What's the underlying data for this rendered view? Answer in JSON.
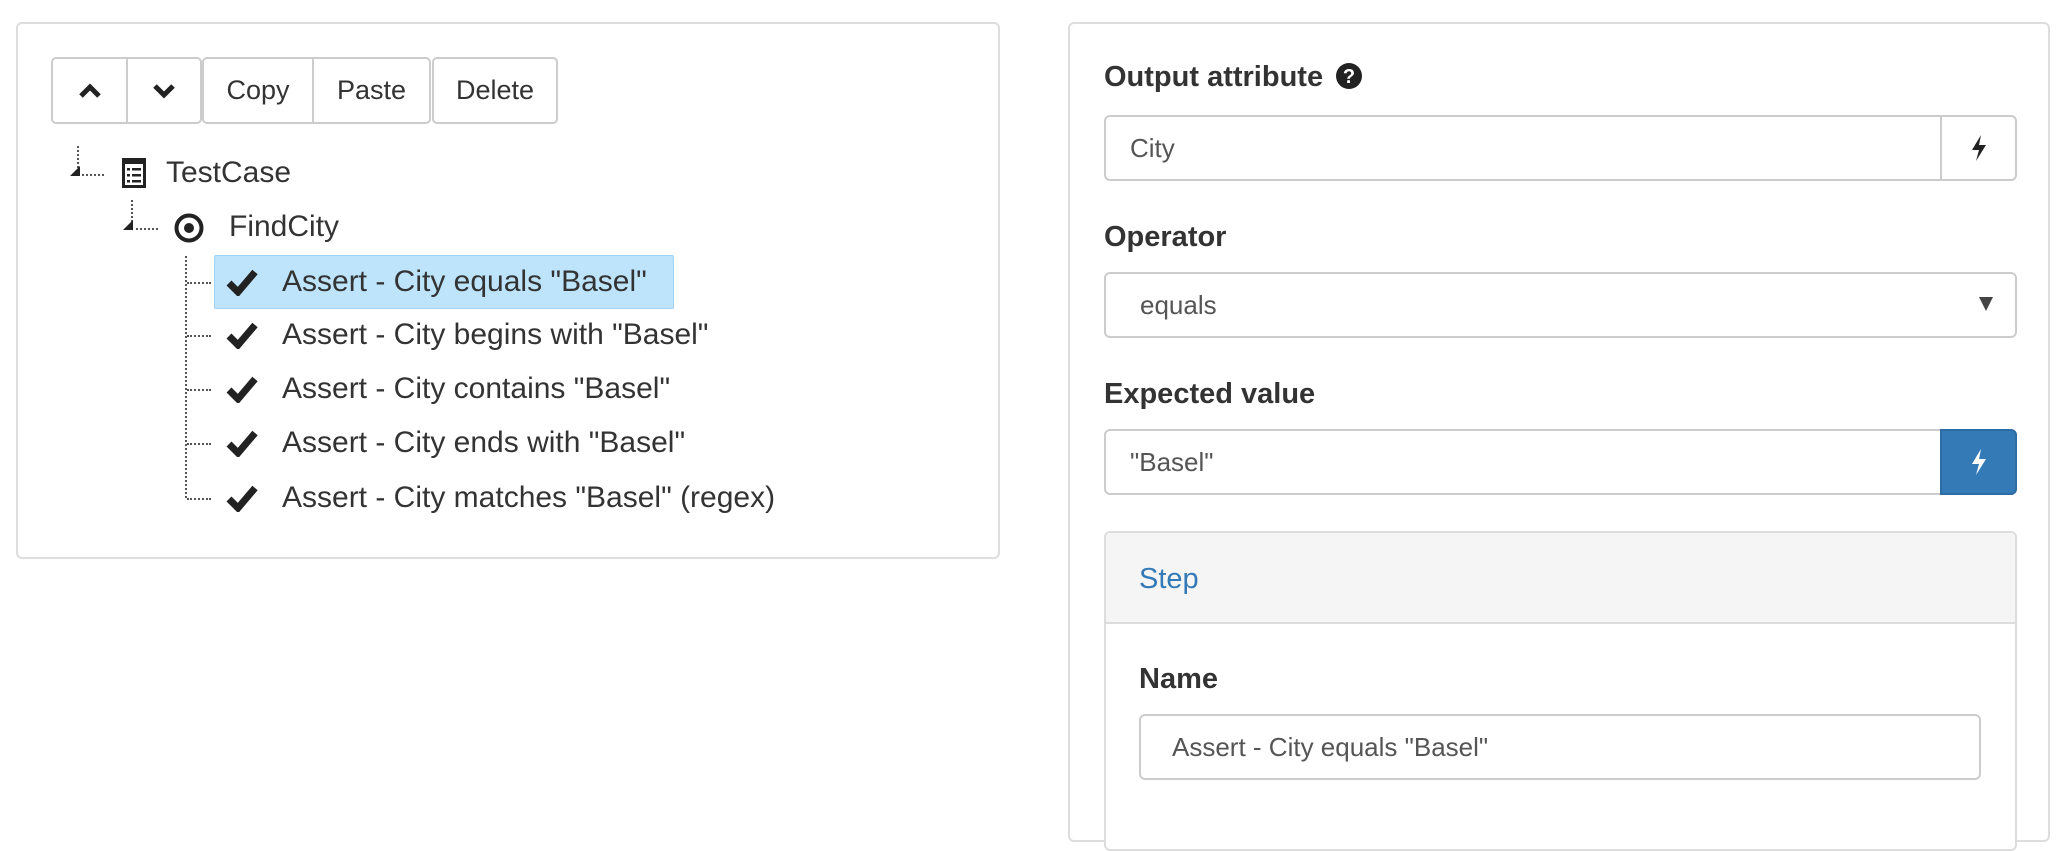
{
  "toolbar": {
    "up_icon": "chevron-up-icon",
    "down_icon": "chevron-down-icon",
    "copy": "Copy",
    "paste": "Paste",
    "delete": "Delete"
  },
  "tree": {
    "root": {
      "label": "TestCase",
      "icon": "list-icon"
    },
    "child": {
      "label": "FindCity",
      "icon": "target-icon"
    },
    "items": [
      {
        "label": "Assert - City equals \"Basel\"",
        "selected": true
      },
      {
        "label": "Assert - City begins with \"Basel\""
      },
      {
        "label": "Assert - City contains \"Basel\""
      },
      {
        "label": "Assert - City ends with \"Basel\""
      },
      {
        "label": "Assert - City matches \"Basel\" (regex)"
      }
    ],
    "selected_color": "#bde4fb"
  },
  "form": {
    "output_attribute": {
      "label": "Output attribute",
      "value": "City"
    },
    "operator": {
      "label": "Operator",
      "value": "equals"
    },
    "expected_value": {
      "label": "Expected value",
      "value": "\"Basel\"",
      "button_color": "#337ab7"
    },
    "step": {
      "title": "Step",
      "name_label": "Name",
      "name_value": "Assert - City equals \"Basel\""
    }
  }
}
